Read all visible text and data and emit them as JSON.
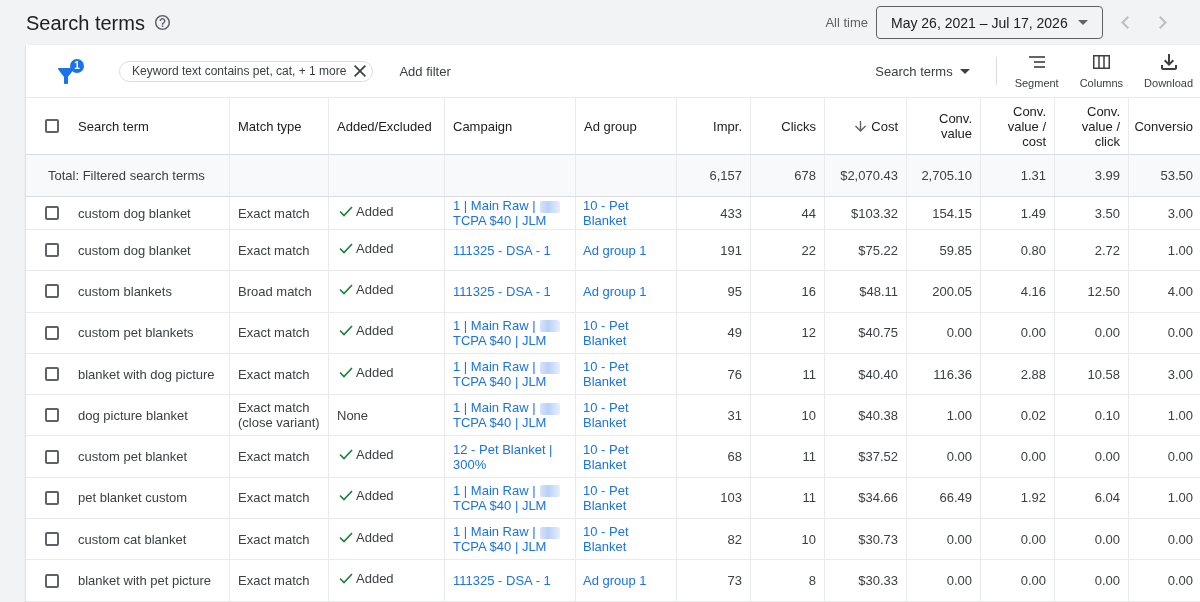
{
  "header": {
    "title": "Search terms",
    "date_label": "All time",
    "date_range": "May 26, 2021 – Jul 17, 2026",
    "nav": [
      {
        "kind": "previous",
        "disabled": true
      },
      {
        "kind": "next",
        "disabled": true
      }
    ]
  },
  "toolbar": {
    "filter_count": "1",
    "filter_chip": "Keyword text contains pet, cat, + 1 more",
    "add_filter": "Add filter",
    "view_menu": "Search terms",
    "actions": [
      {
        "kind": "segment",
        "label": "Segment"
      },
      {
        "kind": "columns",
        "label": "Columns"
      },
      {
        "kind": "download",
        "label": "Download"
      }
    ]
  },
  "table": {
    "select_all": {
      "checked": false
    },
    "columns": [
      {
        "label": "Search term",
        "kind": "text",
        "sorted": false
      },
      {
        "label": "Match type",
        "kind": "text",
        "sorted": false
      },
      {
        "label": "Added/Excluded",
        "kind": "text",
        "sorted": false
      },
      {
        "label": "Campaign",
        "kind": "text",
        "sorted": false
      },
      {
        "label": "Ad group",
        "kind": "text",
        "sorted": false
      },
      {
        "label": "Impr.",
        "kind": "metric",
        "sorted": false
      },
      {
        "label": "Clicks",
        "kind": "metric",
        "sorted": false
      },
      {
        "label": "Cost",
        "kind": "metric",
        "sorted": true
      },
      {
        "label": "Conv. value",
        "kind": "metric",
        "sorted": false
      },
      {
        "label": "Conv. value / cost",
        "kind": "metric",
        "sorted": false
      },
      {
        "label": "Conv. value / click",
        "kind": "metric",
        "sorted": false
      },
      {
        "label": "Conversio",
        "kind": "metric",
        "sorted": false
      }
    ],
    "total": {
      "label": "Total: Filtered search terms",
      "values": [
        "6,157",
        "678",
        "$2,070.43",
        "2,705.10",
        "1.31",
        "3.99",
        "53.50"
      ]
    },
    "rows": [
      {
        "checked": false,
        "search_term": "custom dog blanket",
        "match_type": "Exact match",
        "status": "Added",
        "added": true,
        "campaign": [
          "1 | Main Raw |",
          "TCPA $40 | JLM"
        ],
        "campaign_blurred": true,
        "ad_group": "10 - Pet Blanket",
        "metrics": [
          "433",
          "44",
          "$103.32",
          "154.15",
          "1.49",
          "3.50",
          "3.00"
        ]
      },
      {
        "checked": false,
        "search_term": "custom dog blanket",
        "match_type": "Exact match",
        "status": "Added",
        "added": true,
        "campaign": [
          "111325 - DSA - 1"
        ],
        "campaign_blurred": false,
        "ad_group": "Ad group 1",
        "metrics": [
          "191",
          "22",
          "$75.22",
          "59.85",
          "0.80",
          "2.72",
          "1.00"
        ]
      },
      {
        "checked": false,
        "search_term": "custom blankets",
        "match_type": "Broad match",
        "status": "Added",
        "added": true,
        "campaign": [
          "111325 - DSA - 1"
        ],
        "campaign_blurred": false,
        "ad_group": "Ad group 1",
        "metrics": [
          "95",
          "16",
          "$48.11",
          "200.05",
          "4.16",
          "12.50",
          "4.00"
        ]
      },
      {
        "checked": false,
        "search_term": "custom pet blankets",
        "match_type": "Exact match",
        "status": "Added",
        "added": true,
        "campaign": [
          "1 | Main Raw |",
          "TCPA $40 | JLM"
        ],
        "campaign_blurred": true,
        "ad_group": "10 - Pet Blanket",
        "metrics": [
          "49",
          "12",
          "$40.75",
          "0.00",
          "0.00",
          "0.00",
          "0.00"
        ]
      },
      {
        "checked": false,
        "search_term": "blanket with dog picture",
        "match_type": "Exact match",
        "status": "Added",
        "added": true,
        "campaign": [
          "1 | Main Raw |",
          "TCPA $40 | JLM"
        ],
        "campaign_blurred": true,
        "ad_group": "10 - Pet Blanket",
        "metrics": [
          "76",
          "11",
          "$40.40",
          "116.36",
          "2.88",
          "10.58",
          "3.00"
        ]
      },
      {
        "checked": false,
        "search_term": "dog picture blanket",
        "match_type": "Exact match (close variant)",
        "status": "None",
        "added": false,
        "campaign": [
          "1 | Main Raw |",
          "TCPA $40 | JLM"
        ],
        "campaign_blurred": true,
        "ad_group": "10 - Pet Blanket",
        "metrics": [
          "31",
          "10",
          "$40.38",
          "1.00",
          "0.02",
          "0.10",
          "1.00"
        ]
      },
      {
        "checked": false,
        "search_term": "custom pet blanket",
        "match_type": "Exact match",
        "status": "Added",
        "added": true,
        "campaign": [
          "12 - Pet Blanket | 300%"
        ],
        "campaign_blurred": false,
        "ad_group": "10 - Pet Blanket",
        "metrics": [
          "68",
          "11",
          "$37.52",
          "0.00",
          "0.00",
          "0.00",
          "0.00"
        ]
      },
      {
        "checked": false,
        "search_term": "pet blanket custom",
        "match_type": "Exact match",
        "status": "Added",
        "added": true,
        "campaign": [
          "1 | Main Raw |",
          "TCPA $40 | JLM"
        ],
        "campaign_blurred": true,
        "ad_group": "10 - Pet Blanket",
        "metrics": [
          "103",
          "11",
          "$34.66",
          "66.49",
          "1.92",
          "6.04",
          "1.00"
        ]
      },
      {
        "checked": false,
        "search_term": "custom cat blanket",
        "match_type": "Exact match",
        "status": "Added",
        "added": true,
        "campaign": [
          "1 | Main Raw |",
          "TCPA $40 | JLM"
        ],
        "campaign_blurred": true,
        "ad_group": "10 - Pet Blanket",
        "metrics": [
          "82",
          "10",
          "$30.73",
          "0.00",
          "0.00",
          "0.00",
          "0.00"
        ]
      },
      {
        "checked": false,
        "search_term": "blanket with pet picture",
        "match_type": "Exact match",
        "status": "Added",
        "added": true,
        "campaign": [
          "111325 - DSA - 1"
        ],
        "campaign_blurred": false,
        "ad_group": "Ad group 1",
        "metrics": [
          "73",
          "8",
          "$30.33",
          "0.00",
          "0.00",
          "0.00",
          "0.00"
        ]
      }
    ]
  }
}
